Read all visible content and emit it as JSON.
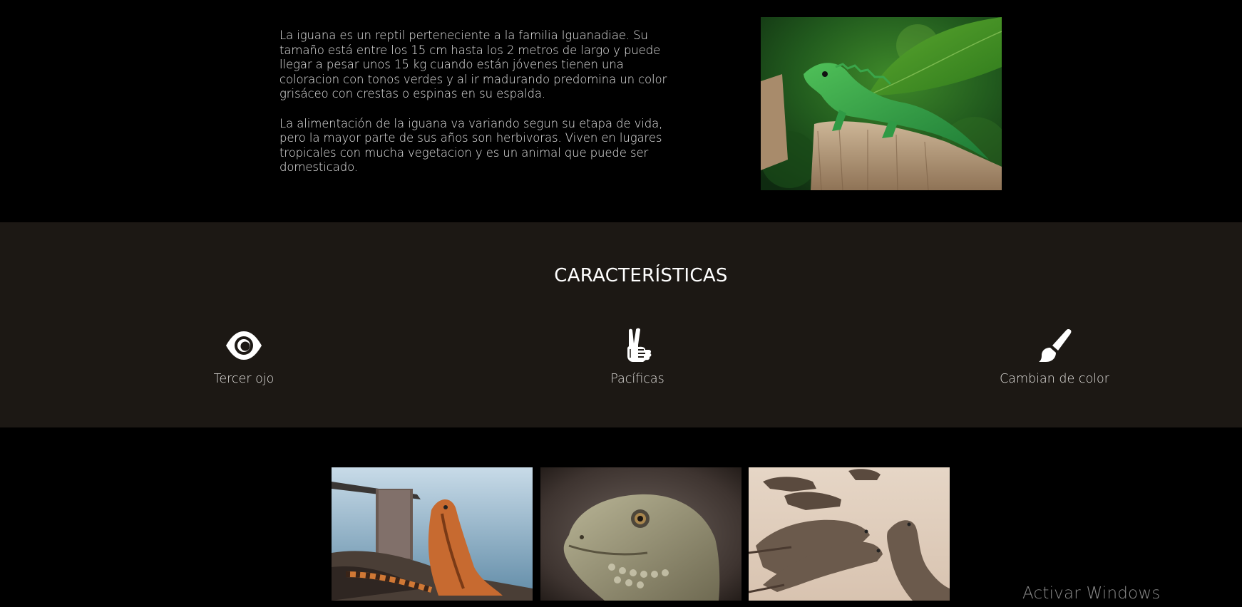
{
  "intro": {
    "paragraphs": [
      "La iguana es un reptil perteneciente a la familia Iguanadiae. Su tamaño está entre los 15 cm hasta los 2 metros de largo y puede llegar a pesar unos 15 kg cuando están jóvenes tienen una coloracion con tonos verdes y al ir madurando predomina un color grisáceo con crestas o espinas en su espalda.",
      "La alimentación de la iguana va variando segun su etapa de vida, pero la mayor parte de sus años son herbivoras. Viven en lugares tropicales con mucha vegetacion y es un animal que puede ser domesticado."
    ],
    "photo_icon": "green-iguana-photo"
  },
  "features": {
    "title": "CARACTERÍSTICAS",
    "items": [
      {
        "label": "Tercer ojo",
        "icon": "eye-icon"
      },
      {
        "label": "Pacíficas",
        "icon": "peace-hand-icon"
      },
      {
        "label": "Cambian de color",
        "icon": "paint-brush-icon"
      }
    ]
  },
  "gallery": {
    "photos": [
      "iguana-by-water-photo",
      "iguana-head-closeup-photo",
      "iguanas-on-sand-photo"
    ]
  },
  "watermark": "Activar Windows",
  "colors": {
    "page_bg": "#000000",
    "features_bg": "#1c1814",
    "text": "#e6e6e6"
  }
}
